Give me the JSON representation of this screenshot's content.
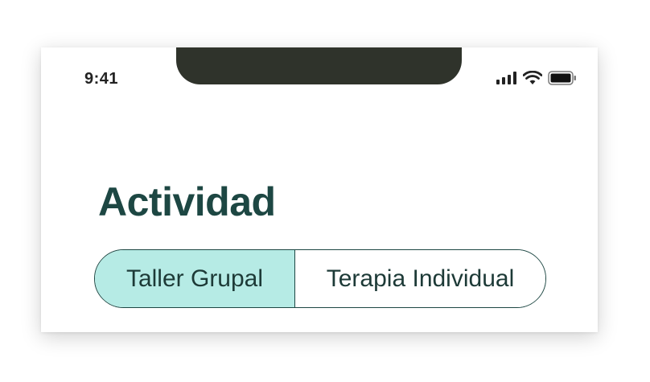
{
  "status_bar": {
    "time": "9:41",
    "icons": [
      "signal-icon",
      "wifi-icon",
      "battery-icon"
    ]
  },
  "page": {
    "title": "Actividad"
  },
  "segmented_control": {
    "options": [
      {
        "label": "Taller Grupal",
        "selected": true
      },
      {
        "label": "Terapia Individual",
        "selected": false
      }
    ]
  },
  "colors": {
    "title": "#1d4743",
    "selected_segment_bg": "#b6ebe5",
    "segment_border": "#1d4743",
    "notch": "#2f332b"
  }
}
